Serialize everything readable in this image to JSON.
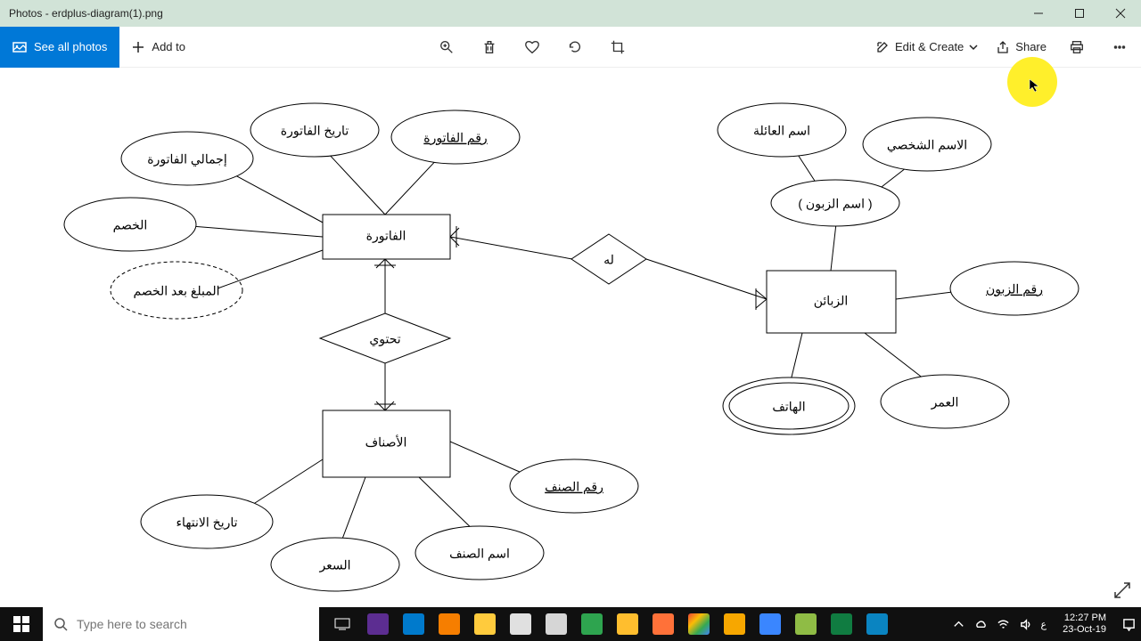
{
  "titlebar": {
    "title": "Photos - erdplus-diagram(1).png"
  },
  "toolbar": {
    "all_photos": "See all photos",
    "add_to": "Add to",
    "edit_create": "Edit & Create",
    "share": "Share"
  },
  "search": {
    "placeholder": "Type here to search"
  },
  "clock": {
    "time": "12:27 PM",
    "date": "23-Oct-19"
  },
  "lang": "ع",
  "erd": {
    "entities": {
      "invoice": "الفاتورة",
      "customers": "الزبائن",
      "items": "الأصناف"
    },
    "relationships": {
      "has": "له",
      "contains": "تحتوي"
    },
    "attrs": {
      "invoice_date": "تاريخ الفاتورة",
      "invoice_no": "رقم الفاتورة",
      "invoice_total": "إجمالي الفاتورة",
      "discount": "الخصم",
      "after_discount": "المبلغ بعد الخصم",
      "family_name": "اسم العائلة",
      "personal_name": "الاسم الشخصي",
      "customer_name": "( اسم الزبون )",
      "customer_no": "رقم الزبون",
      "phone": "الهاتف",
      "age": "العمر",
      "item_no": "رقم الصنف",
      "item_name": "اسم الصنف",
      "price": "السعر",
      "expiry": "تاريخ الانتهاء"
    }
  }
}
